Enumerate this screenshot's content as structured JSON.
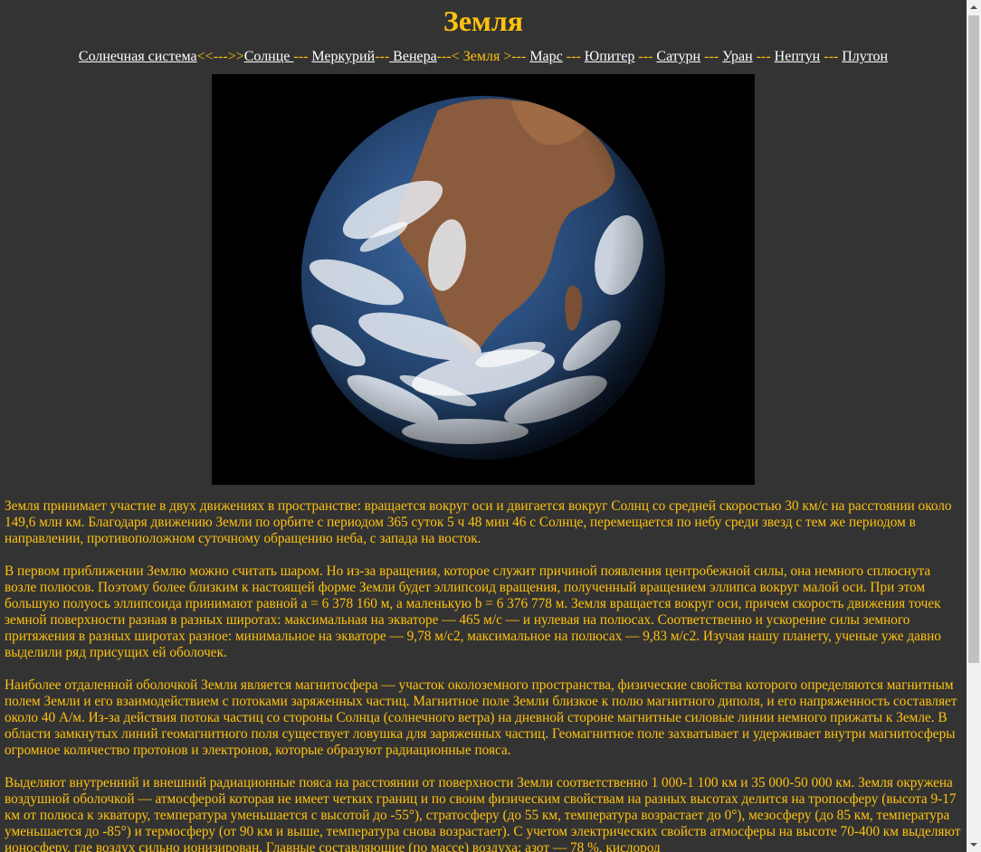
{
  "page": {
    "title": "Земля"
  },
  "nav": {
    "solar_system": "Солнечная система",
    "arrow": "<<--->>",
    "sun": "Солнце ",
    "mercury": "Меркурий",
    "venus": " Венера",
    "current": "< Земля >",
    "mars": "Марс",
    "jupiter": "Юпитер",
    "saturn": "Сатурн",
    "uranus": "Уран",
    "neptune": "Нептун",
    "pluto": "Плутон",
    "sep_dashes": " --- ",
    "sep_dashes_tight": "---",
    "sep_venus_pre": "---",
    "sep_after_current": "--- "
  },
  "image": {
    "subject": "earth-photo"
  },
  "paragraphs": [
    "Земля принимает участие в двух движениях в пространстве: вращается вокруг оси и двигается вокруг Солнц со средней скоростью 30 км/с на расстоянии около 149,6 млн км. Благодаря движению Земли по орбите с периодом 365 суток 5 ч 48 мин 46 с Солнце, перемещается по небу среди звезд с тем же периодом в направлении, противоположном суточному обращению неба, с запада на восток.",
    "В первом приближении Землю можно считать шаром. Но из-за вращения, которое служит причиной появления центробежной силы, она немного сплюснута возле полюсов. Поэтому более близким к настоящей форме Земли будет эллипсоид вращения, полученный вращением эллипса вокруг малой оси. При этом большую полуось эллипсоида принимают равной a = 6 378 160 м, а маленькую b = 6 376 778 м. Земля вращается вокруг оси, причем скорость движения точек земной поверхности разная в разных широтах: максимальная на экваторе — 465 м/с — и нулевая на полюсах. Соответственно и ускорение силы земного притяжения в разных широтах разное: минимальное на экваторе — 9,78 м/с2, максимальное на полюсах — 9,83 м/с2. Изучая нашу планету, ученые уже давно выделили ряд присущих ей оболочек.",
    "Наиболее отдаленной оболочкой Земли является магнитосфера — участок околоземного пространства, физические свойства которого определяются магнитным полем Земли и его взаимодействием с потоками заряженных частиц. Магнитное поле Земли близкое к полю магнитного диполя, и его напряженность составляет около 40 А/м. Из-за действия потока частиц со стороны Солнца (солнечного ветра) на дневной стороне магнитные силовые линии немного прижаты к Земле. В области замкнутых линий геомагнитного поля существует ловушка для заряженных частиц. Геомагнитное поле захватывает и удерживает внутри магнитосферы огромное количество протонов и электронов, которые образуют радиационные пояса.",
    "Выделяют внутренний и внешний радиационные пояса на расстоянии от поверхности Земли соответственно 1 000-1 100 км и 35 000-50 000 км. Земля окружена воздушной оболочкой — атмосферой которая не имеет четких границ и по своим физическим свойствам на разных высотах делится на тропосферу (высота 9-17 км от полюса к экватору, температура уменьшается с высотой до -55°), стратосферу (до 55 км, температура возрастает до 0°), мезосферу (до 85 км, температура уменьшается до -85°) и термосферу (от 90 км и выше, температура снова возрастает). С учетом электрических свойств атмосферы на высоте 70-400 км выделяют ионосферу, где воздух сильно ионизирован. Главные составляющие (по массе) воздуха: азот — 78 %, кислород"
  ],
  "colors": {
    "background": "#333333",
    "text": "#FFC20E",
    "link": "#FFFFFF"
  }
}
